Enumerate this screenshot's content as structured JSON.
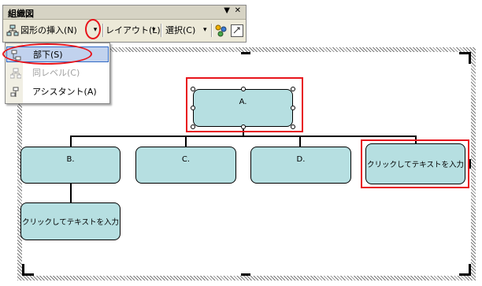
{
  "toolbar": {
    "title": "組織図",
    "insert_shape_label": "図形の挿入(N)",
    "layout_label": "レイアウト(L)",
    "select_label": "選択(C)"
  },
  "menu": {
    "items": [
      {
        "label": "部下(S)",
        "state": "highlighted"
      },
      {
        "label": "同レベル(C)",
        "state": "disabled"
      },
      {
        "label": "アシスタント(A)",
        "state": "normal"
      }
    ]
  },
  "chart": {
    "top_node": "A.",
    "level2": [
      "B.",
      "C.",
      "D.",
      "クリックしてテキストを入力"
    ],
    "subordinate": "クリックしてテキストを入力"
  },
  "colors": {
    "node_fill": "#b6dfe1",
    "highlight_red": "#e8141b",
    "toolbar_bg": "#ece9d8",
    "menu_selection": "#c1d2ee"
  }
}
